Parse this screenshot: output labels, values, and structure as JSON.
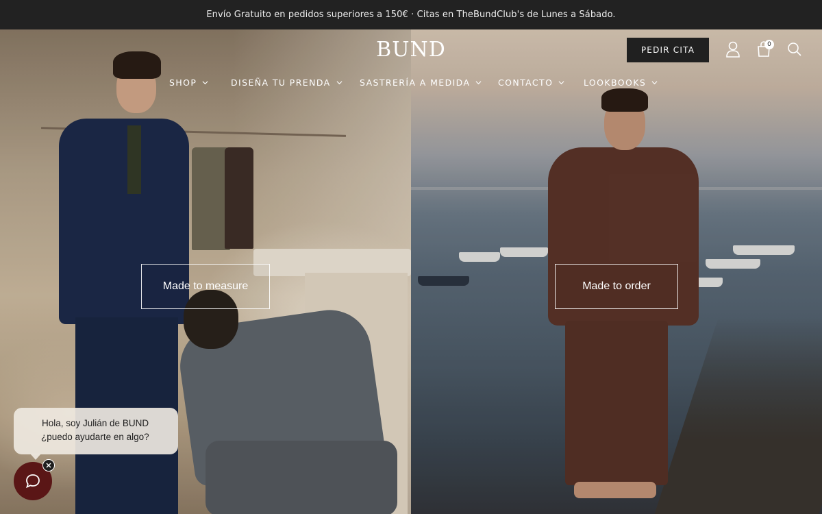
{
  "announcement": {
    "text": "Envío Gratuito en pedidos superiores a 150€ · Citas en TheBundClub's de Lunes a Sábado."
  },
  "header": {
    "logo": "BUND",
    "cta_label": "PEDIR CITA",
    "cart_count": "0",
    "icons": [
      "account-icon",
      "cart-icon",
      "search-icon"
    ]
  },
  "nav": {
    "items": [
      {
        "label": "SHOP"
      },
      {
        "label": "DISEÑA TU PRENDA"
      },
      {
        "label": "SASTRERÍA A MEDIDA"
      },
      {
        "label": "CONTACTO"
      },
      {
        "label": "LOOKBOOKS"
      }
    ]
  },
  "hero": {
    "left_cta": "Made to measure",
    "right_cta": "Made to order"
  },
  "chat": {
    "line1": "Hola, soy Julián de BUND",
    "line2": "¿puedo ayudarte en algo?"
  }
}
